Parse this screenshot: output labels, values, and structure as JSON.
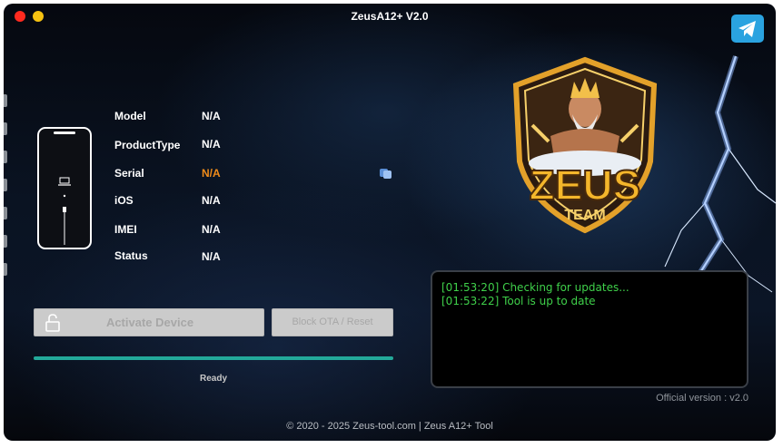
{
  "window": {
    "title": "ZeusA12+ V2.0"
  },
  "device_info": [
    {
      "label": "Model",
      "value": "N/A"
    },
    {
      "label": "ProductType",
      "value": "N/A"
    },
    {
      "label": "Serial",
      "value": "N/A"
    },
    {
      "label": "iOS",
      "value": "N/A"
    },
    {
      "label": "IMEI",
      "value": "N/A"
    },
    {
      "label": "Status",
      "value": "N/A"
    }
  ],
  "colors": {
    "serial_value": "#f08c1a",
    "log_text": "#3fd04a",
    "progress": "#23a99a",
    "telegram": "#2aa3e0"
  },
  "buttons": {
    "activate": "Activate Device",
    "block_ota": "Block OTA / Reset"
  },
  "progress": {
    "fraction": 1.0,
    "status": "Ready"
  },
  "log": [
    "[01:53:20] Checking for updates...",
    "[01:53:22] Tool is up to date"
  ],
  "logo": {
    "title": "ZEUS",
    "subtitle": "TEAM"
  },
  "icons": {
    "telegram": "telegram-icon",
    "copy": "copy-icon",
    "lock": "lock-icon",
    "laptop": "laptop-icon",
    "cable": "cable-icon"
  },
  "version": "Official version : v2.0",
  "footer": "© 2020 - 2025 Zeus-tool.com |  Zeus A12+ Tool"
}
